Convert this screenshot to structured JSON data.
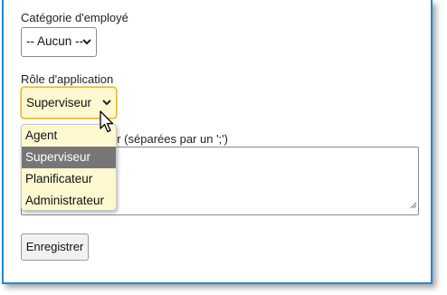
{
  "form": {
    "employee_category": {
      "label": "Catégorie d'employé",
      "value": "-- Aucun --"
    },
    "app_role": {
      "label": "Rôle d'application",
      "value": "Superviseur",
      "options": [
        "Agent",
        "Superviseur",
        "Planificateur",
        "Administrateur"
      ],
      "selected_index": 1
    },
    "textarea": {
      "label_visible_part": "ur (séparées par un ';')",
      "value": ""
    },
    "save_label": "Enregistrer"
  },
  "colors": {
    "frame_border": "#1e88d8",
    "active_select_bg": "#fdf8cf",
    "active_select_border": "#e8b62b",
    "selected_option_bg": "#767676"
  },
  "icons": {
    "select_arrow": "chevron-down-icon",
    "cursor": "mouse-pointer-icon",
    "resize": "resize-grip-icon"
  }
}
